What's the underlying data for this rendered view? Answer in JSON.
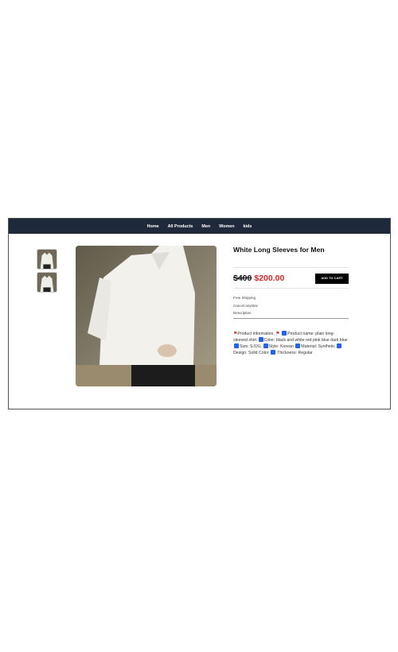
{
  "nav": {
    "links": [
      "Home",
      "All Products",
      "Men",
      "Women",
      "kids"
    ]
  },
  "product": {
    "title": "White Long Sleeves for Men",
    "old_price": "$400",
    "new_price": "$200.00",
    "add_to_cart_label": "ADD TO CART",
    "meta": [
      "Free Shipping",
      "Cancel anytime",
      "Description"
    ],
    "description": {
      "part1": "Product information",
      "part2": "Product name: plain long-sleeved shirt",
      "part3": "Color: black and white red pink blue dark blue",
      "part4": "Size: S-5XL",
      "part5": "Style: Korean",
      "part6": "Material: Synthetic",
      "part7": "Design: Solid Color",
      "part8": "Thickness: Regular"
    }
  },
  "colors": {
    "navbar": "#1e293b",
    "sale_price": "#dc2626",
    "button": "#000000"
  }
}
